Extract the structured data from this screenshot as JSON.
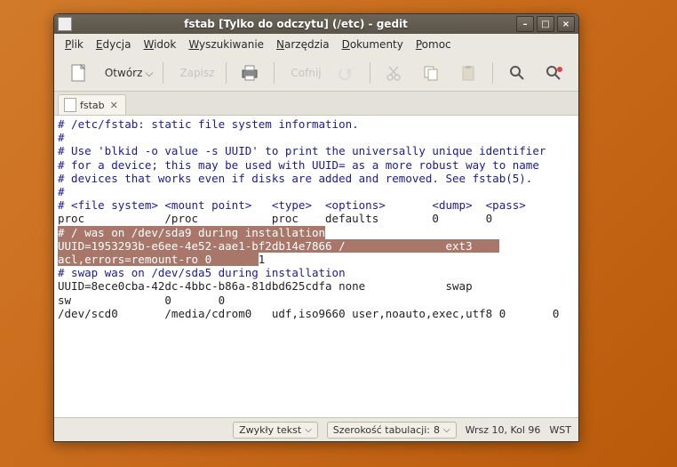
{
  "window": {
    "title": "fstab [Tylko do odczytu] (/etc) - gedit"
  },
  "menu": {
    "plik": "Plik",
    "edycja": "Edycja",
    "widok": "Widok",
    "wyszukiwanie": "Wyszukiwanie",
    "narzedzia": "Narzędzia",
    "dokumenty": "Dokumenty",
    "pomoc": "Pomoc"
  },
  "toolbar": {
    "open": "Otwórz",
    "save": "Zapisz",
    "undo": "Cofnij"
  },
  "tab": {
    "name": "fstab"
  },
  "content": {
    "l1": "# /etc/fstab: static file system information.",
    "l2": "#",
    "l3": "# Use 'blkid -o value -s UUID' to print the universally unique identifier",
    "l4": "# for a device; this may be used with UUID= as a more robust way to name",
    "l5": "# devices that works even if disks are added and removed. See fstab(5).",
    "l6": "#",
    "l7": "# <file system> <mount point>   <type>  <options>       <dump>  <pass>",
    "l8": "proc            /proc           proc    defaults        0       0",
    "l9": "# / was on /dev/sda9 during installation",
    "l10": "UUID=1953293b-e6ee-4e52-aae1-bf2db14e7866 /               ext3    ",
    "l11a": "acl,errors=remount-ro 0       ",
    "l11b": "1",
    "l12": "# swap was on /dev/sda5 during installation",
    "l13": "UUID=8ece0cba-42dc-4bbc-b86a-81dbd625cdfa none            swap    ",
    "l14": "sw              0       0",
    "l15": "/dev/scd0       /media/cdrom0   udf,iso9660 user,noauto,exec,utf8 0       0"
  },
  "status": {
    "syntax": "Zwykły tekst",
    "tabwidth_label": "Szerokość tabulacji:",
    "tabwidth_value": "8",
    "position": "Wrsz 10, Kol 96",
    "mode": "WST"
  }
}
